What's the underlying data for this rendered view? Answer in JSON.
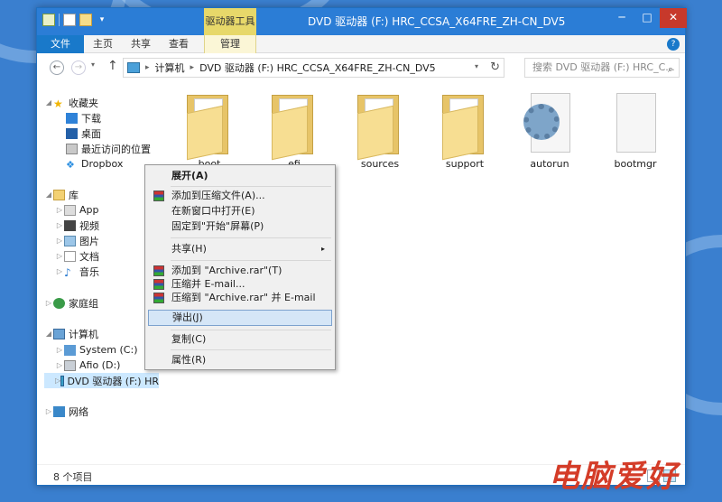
{
  "window": {
    "title": "DVD 驱动器 (F:) HRC_CCSA_X64FRE_ZH-CN_DV5",
    "context_tab_header": "驱动器工具",
    "controls": {
      "minimize": "─",
      "maximize": "□",
      "close": "✕"
    }
  },
  "quick_access": {
    "dropdown": "▾"
  },
  "ribbon": {
    "tabs": [
      {
        "label": "文件"
      },
      {
        "label": "主页"
      },
      {
        "label": "共享"
      },
      {
        "label": "查看"
      },
      {
        "label": "管理"
      }
    ],
    "help": "?"
  },
  "address_bar": {
    "back": "←",
    "forward": "→",
    "recent": "▾",
    "up": "↑",
    "separator": "▸",
    "path": [
      "计算机",
      "DVD 驱动器 (F:) HRC_CCSA_X64FRE_ZH-CN_DV5"
    ],
    "dropdown": "▾",
    "refresh": "↻",
    "search_placeholder": "搜索 DVD 驱动器 (F:) HRC_C...",
    "search_icon": "⌕"
  },
  "nav_pane": {
    "favorites": {
      "label": "收藏夹",
      "items": [
        "下载",
        "桌面",
        "最近访问的位置",
        "Dropbox"
      ]
    },
    "libraries": {
      "label": "库",
      "items": [
        "App",
        "视频",
        "图片",
        "文档",
        "音乐"
      ]
    },
    "homegroup": {
      "label": "家庭组"
    },
    "computer": {
      "label": "计算机",
      "items": [
        "System (C:)",
        "Afio (D:)",
        "DVD 驱动器 (F:) HR"
      ]
    },
    "network": {
      "label": "网络"
    }
  },
  "files": [
    {
      "name": "boot",
      "type": "folder"
    },
    {
      "name": "efi",
      "type": "folder"
    },
    {
      "name": "sources",
      "type": "folder"
    },
    {
      "name": "support",
      "type": "folder"
    },
    {
      "name": "autorun",
      "type": "settings-file"
    },
    {
      "name": "bootmgr",
      "type": "file"
    }
  ],
  "status": {
    "item_count": "8 个项目"
  },
  "context_menu": {
    "items": [
      {
        "label": "展开(A)"
      },
      {
        "label": "添加到压缩文件(A)..."
      },
      {
        "label": "在新窗口中打开(E)"
      },
      {
        "label": "固定到\"开始\"屏幕(P)"
      },
      {
        "label": "共享(H)"
      },
      {
        "label": "添加到 \"Archive.rar\"(T)"
      },
      {
        "label": "压缩并 E-mail..."
      },
      {
        "label": "压缩到 \"Archive.rar\" 并 E-mail"
      },
      {
        "label": "弹出(J)"
      },
      {
        "label": "复制(C)"
      },
      {
        "label": "属性(R)"
      }
    ],
    "submenu_arrow": "▸"
  },
  "watermark": "电脑爱好"
}
